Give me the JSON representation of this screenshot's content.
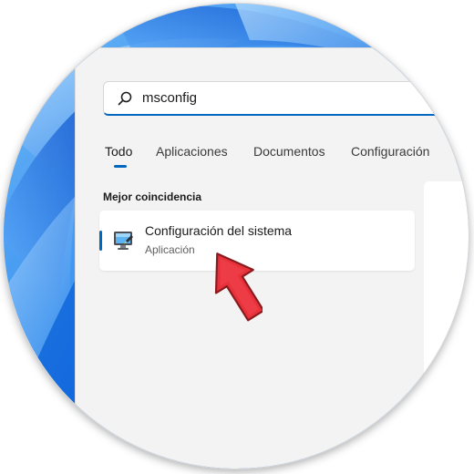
{
  "search": {
    "query": "msconfig",
    "icon": "search-icon"
  },
  "tabs": [
    {
      "label": "Todo",
      "active": true
    },
    {
      "label": "Aplicaciones",
      "active": false
    },
    {
      "label": "Documentos",
      "active": false
    },
    {
      "label": "Configuración",
      "active": false
    }
  ],
  "best_match": {
    "heading": "Mejor coincidencia",
    "result": {
      "title": "Configuración del sistema",
      "subtitle": "Aplicación",
      "icon": "system-configuration-icon"
    }
  },
  "annotation": {
    "icon": "pointer-arrow-icon",
    "color": "#e8313a"
  },
  "colors": {
    "accent": "#0067c0",
    "panel_background": "#f3f3f3",
    "wallpaper_blue": "#1a73e8"
  }
}
